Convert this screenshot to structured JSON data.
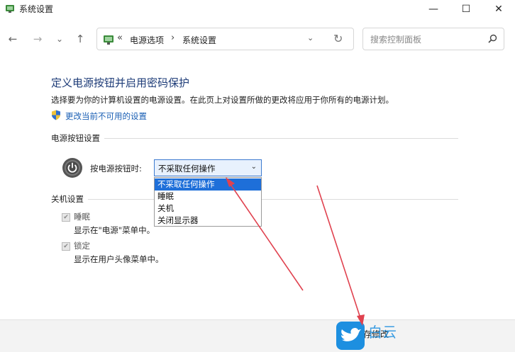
{
  "window": {
    "title": "系统设置"
  },
  "titlebar_buttons": {
    "minimize": "—",
    "maximize": "☐",
    "close": "✕"
  },
  "nav": {
    "back": "←",
    "forward": "→",
    "recent": "⌄",
    "up": "↑"
  },
  "address": {
    "sep": "«",
    "seg1": "电源选项",
    "sep2": "›",
    "seg2": "系统设置",
    "dropdown": "⌄",
    "refresh": "↻"
  },
  "search": {
    "placeholder": "搜索控制面板"
  },
  "main": {
    "title": "定义电源按钮并启用密码保护",
    "description": "选择要为你的计算机设置的电源设置。在此页上对设置所做的更改将应用于你所有的电源计划。",
    "change_link": "更改当前不可用的设置"
  },
  "power_section": {
    "heading": "电源按钮设置",
    "press_label": "按电源按钮时:",
    "selected": "不采取任何操作",
    "caret": "⌄",
    "options": [
      "不采取任何操作",
      "睡眠",
      "关机",
      "关闭显示器"
    ]
  },
  "shutdown_section": {
    "heading": "关机设置",
    "items": [
      {
        "label": "睡眠",
        "sub": "显示在\"电源\"菜单中。"
      },
      {
        "label": "锁定",
        "sub": "显示在用户头像菜单中。"
      }
    ],
    "check": "✔"
  },
  "footer": {
    "save": "保存修改"
  },
  "watermark": {
    "text": "白云"
  },
  "colors": {
    "accent": "#1e6fd9",
    "title": "#1e3c78",
    "link": "#1a5fb4",
    "arrow": "#e0424f"
  },
  "icons": {
    "app": "control-panel-icon",
    "address": "control-panel-icon",
    "search": "search-icon",
    "shield": "uac-shield-icon",
    "power": "power-icon"
  }
}
